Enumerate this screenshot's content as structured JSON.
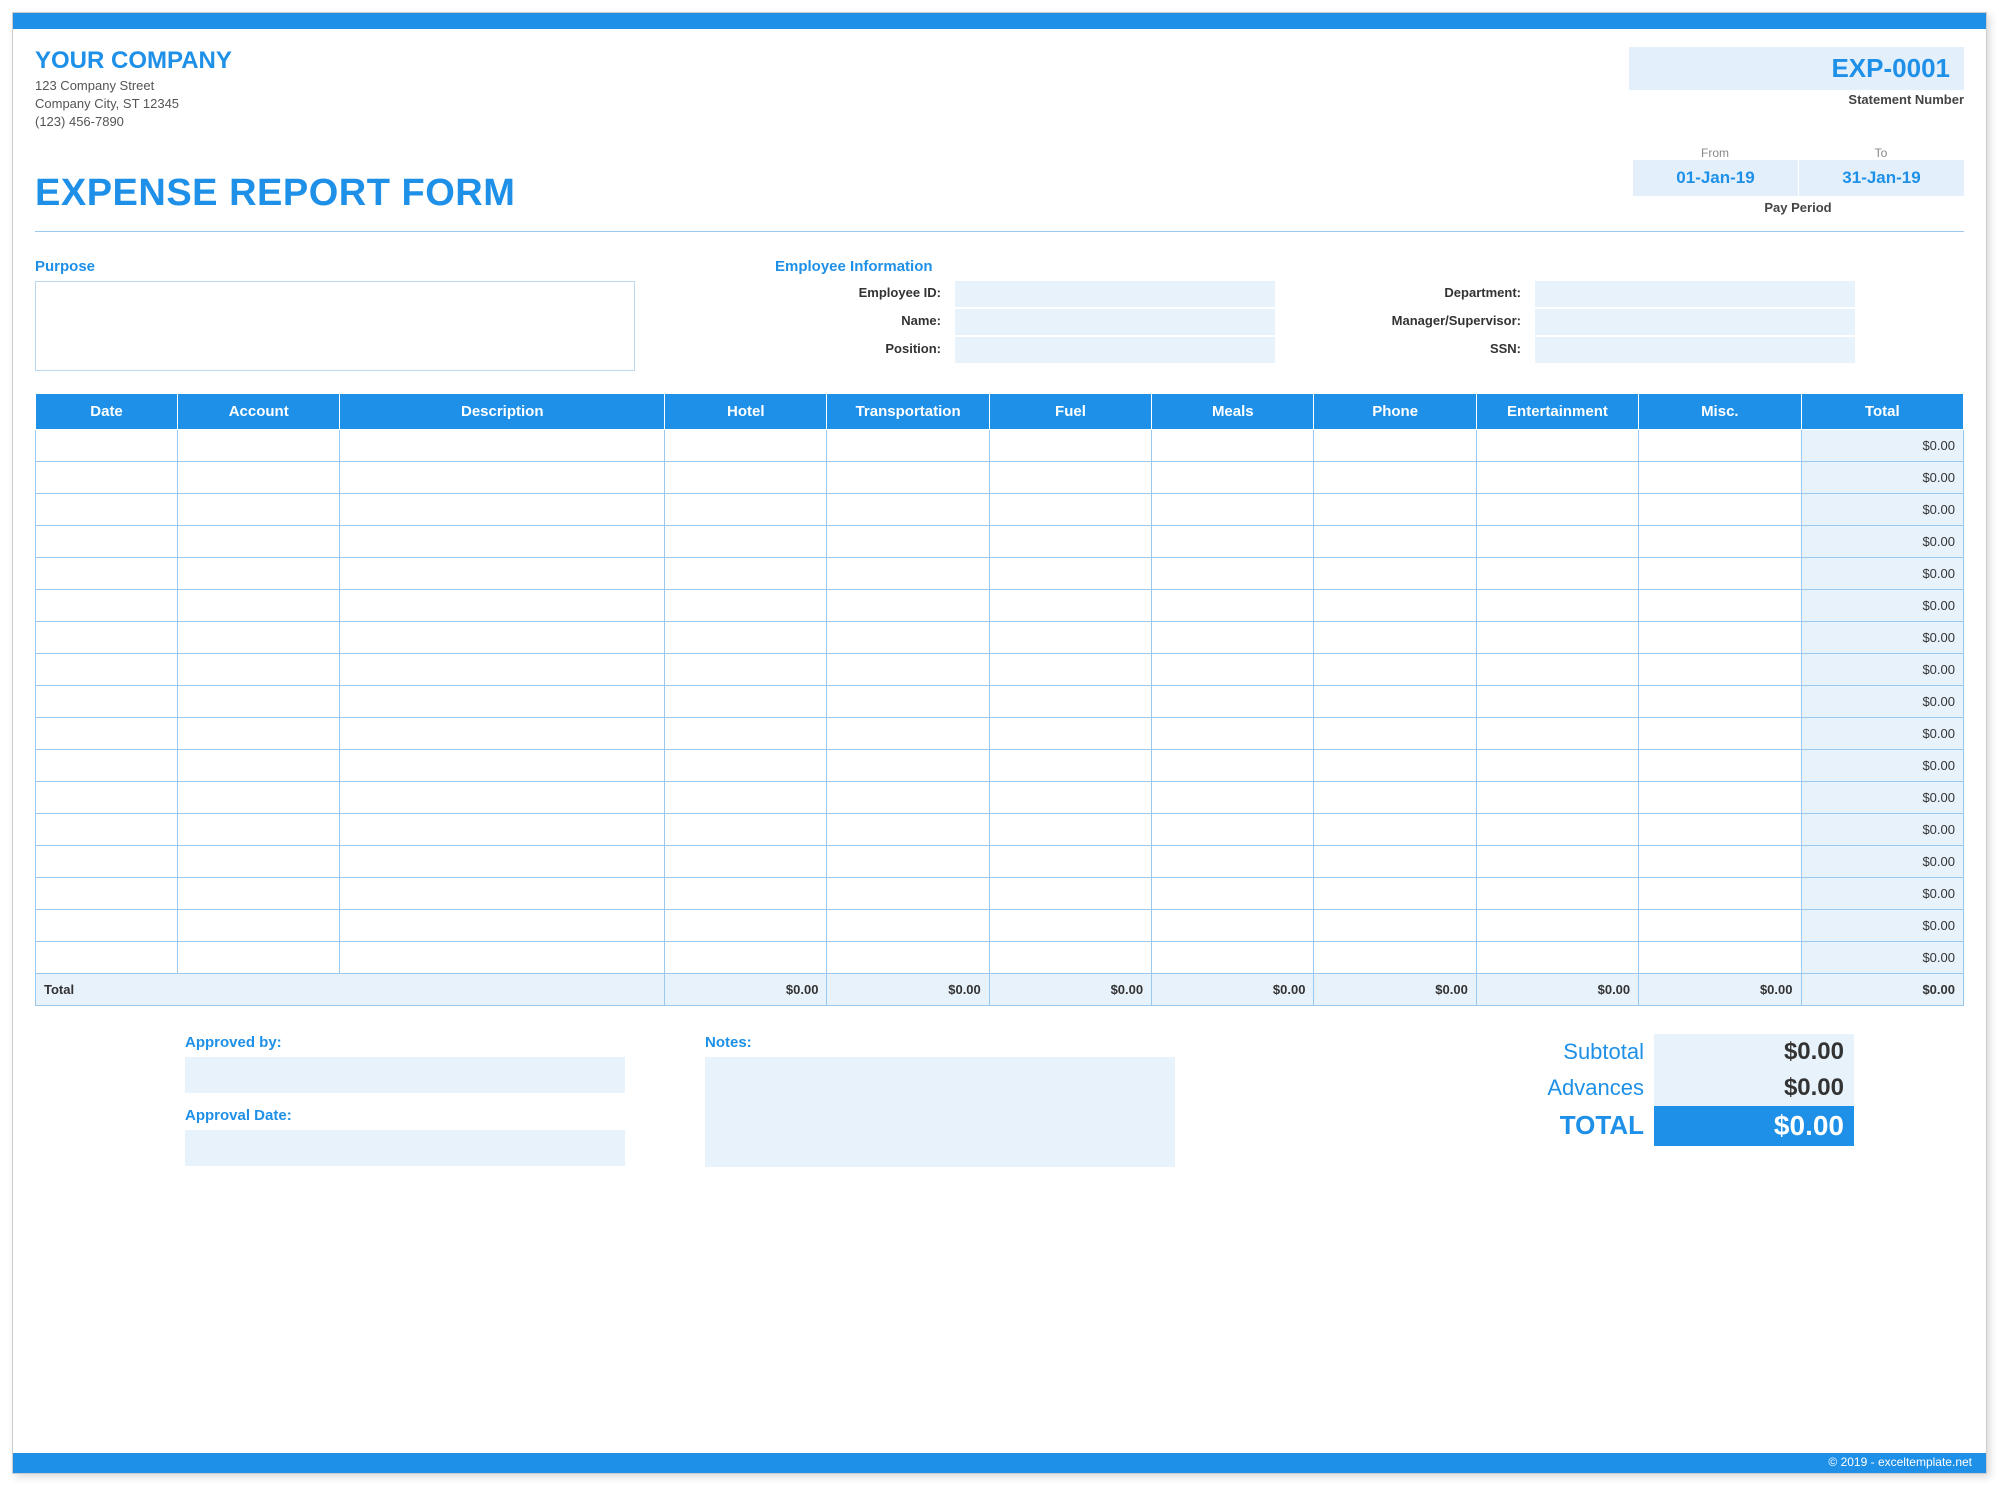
{
  "company": {
    "name": "YOUR COMPANY",
    "street": "123 Company Street",
    "city": "Company City, ST 12345",
    "phone": "(123) 456-7890"
  },
  "statement": {
    "number": "EXP-0001",
    "label": "Statement Number"
  },
  "title": "EXPENSE REPORT FORM",
  "period": {
    "from_label": "From",
    "to_label": "To",
    "from": "01-Jan-19",
    "to": "31-Jan-19",
    "label": "Pay Period"
  },
  "purpose": {
    "label": "Purpose"
  },
  "employee": {
    "header": "Employee Information",
    "labels": {
      "id": "Employee ID:",
      "name": "Name:",
      "position": "Position:",
      "department": "Department:",
      "manager": "Manager/Supervisor:",
      "ssn": "SSN:"
    }
  },
  "columns": [
    "Date",
    "Account",
    "Description",
    "Hotel",
    "Transportation",
    "Fuel",
    "Meals",
    "Phone",
    "Entertainment",
    "Misc.",
    "Total"
  ],
  "col_widths": [
    "7%",
    "8%",
    "16%",
    "8%",
    "8%",
    "8%",
    "8%",
    "8%",
    "8%",
    "8%",
    "8%"
  ],
  "row_totals": [
    "$0.00",
    "$0.00",
    "$0.00",
    "$0.00",
    "$0.00",
    "$0.00",
    "$0.00",
    "$0.00",
    "$0.00",
    "$0.00",
    "$0.00",
    "$0.00",
    "$0.00",
    "$0.00",
    "$0.00",
    "$0.00",
    "$0.00"
  ],
  "total_row": {
    "label": "Total",
    "values": [
      "$0.00",
      "$0.00",
      "$0.00",
      "$0.00",
      "$0.00",
      "$0.00",
      "$0.00",
      "$0.00"
    ]
  },
  "approval": {
    "by_label": "Approved by:",
    "date_label": "Approval Date:"
  },
  "notes": {
    "label": "Notes:"
  },
  "summary": {
    "subtotal": {
      "label": "Subtotal",
      "value": "$0.00"
    },
    "advances": {
      "label": "Advances",
      "value": "$0.00"
    },
    "total": {
      "label": "TOTAL",
      "value": "$0.00"
    }
  },
  "footer": "© 2019 - exceltemplate.net"
}
